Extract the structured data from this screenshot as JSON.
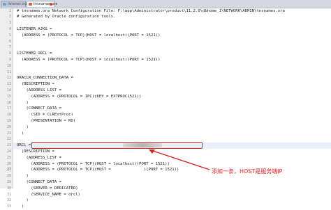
{
  "tabs": [
    {
      "label": "listener.ora"
    },
    {
      "label": "tnsnames.ora"
    }
  ],
  "lines": [
    {
      "num": "1",
      "text": "# tnsnames.ora Network Configuration File: F:\\app\\Administrator\\product\\11.2.0\\dbhome_1\\NETWORK\\ADMIN\\tnsnames.ora"
    },
    {
      "num": "2",
      "text": "# Generated by Oracle configuration tools."
    },
    {
      "num": "3",
      "text": ""
    },
    {
      "num": "4",
      "text": "LISTENER_AJKS ="
    },
    {
      "num": "5",
      "text": "  (ADDRESS = (PROTOCOL = TCP)(HOST = localhost)(PORT = 1521))"
    },
    {
      "num": "6",
      "text": ""
    },
    {
      "num": "7",
      "text": ""
    },
    {
      "num": "8",
      "text": "LISTENER_ORCL ="
    },
    {
      "num": "9",
      "text": "  (ADDRESS = (PROTOCOL = TCP)(HOST = localhost)(PORT = 1521))"
    },
    {
      "num": "10",
      "text": ""
    },
    {
      "num": "11",
      "text": ""
    },
    {
      "num": "12",
      "text": "ORACLR_CONNECTION_DATA ="
    },
    {
      "num": "13",
      "text": "  (DESCRIPTION ="
    },
    {
      "num": "14",
      "text": "    (ADDRESS_LIST ="
    },
    {
      "num": "15",
      "text": "      (ADDRESS = (PROTOCOL = IPC)(KEY = EXTPROC1521))"
    },
    {
      "num": "16",
      "text": "    )"
    },
    {
      "num": "17",
      "text": "    (CONNECT_DATA ="
    },
    {
      "num": "18",
      "text": "      (SID = CLRExtProc)"
    },
    {
      "num": "19",
      "text": "      (PRESENTATION = RO)"
    },
    {
      "num": "20",
      "text": "    )"
    },
    {
      "num": "21",
      "text": "  )"
    },
    {
      "num": "22",
      "text": ""
    },
    {
      "num": "23",
      "text": "ORCL ="
    },
    {
      "num": "24",
      "text": "  (DESCRIPTION ="
    },
    {
      "num": "25",
      "text": "    (ADDRESS_LIST ="
    },
    {
      "num": "26",
      "text": "      (ADDRESS = (PROTOCOL = TCP)(HOST = localhost)(PORT = 1521))"
    },
    {
      "num": "27",
      "text": "      (ADDRESS = (PROTOCOL = TCP)(HOST =              )(PORT = 1521))"
    },
    {
      "num": "28",
      "text": "    )"
    },
    {
      "num": "29",
      "text": "    (CONNECT_DATA ="
    },
    {
      "num": "30",
      "text": "      (SERVER = DEDICATED)"
    },
    {
      "num": "31",
      "text": "      (SERVICE_NAME = orcl)"
    },
    {
      "num": "32",
      "text": "    )"
    },
    {
      "num": "33",
      "text": "  )"
    }
  ],
  "current_line": "27",
  "annotation": {
    "text": "添加一条，HOST是服务端IP",
    "color": "#e0231f"
  },
  "icons": {
    "tab_file": "document-icon",
    "tab_close": "close-icon",
    "arrow": "arrow-icon"
  }
}
